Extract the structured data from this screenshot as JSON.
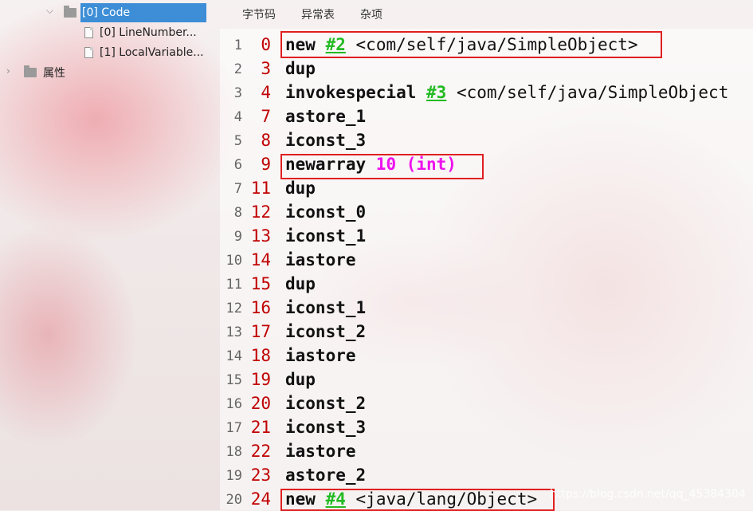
{
  "tree": {
    "code_node": "[0] Code",
    "line_number_node": "[0] LineNumber...",
    "local_variable_node": "[1] LocalVariable...",
    "attributes_node": "属性"
  },
  "tabs": [
    {
      "label": "字节码",
      "active": true
    },
    {
      "label": "异常表",
      "active": false
    },
    {
      "label": "杂项",
      "active": false
    }
  ],
  "code_lines": [
    {
      "ln": "1",
      "offset": "0",
      "op": "new",
      "ref": "#2",
      "arg": " <com/self/java/SimpleObject>",
      "lit": ""
    },
    {
      "ln": "2",
      "offset": "3",
      "op": "dup",
      "ref": "",
      "arg": "",
      "lit": ""
    },
    {
      "ln": "3",
      "offset": "4",
      "op": "invokespecial",
      "ref": "#3",
      "arg": " <com/self/java/SimpleObject",
      "lit": ""
    },
    {
      "ln": "4",
      "offset": "7",
      "op": "astore_1",
      "ref": "",
      "arg": "",
      "lit": ""
    },
    {
      "ln": "5",
      "offset": "8",
      "op": "iconst_3",
      "ref": "",
      "arg": "",
      "lit": ""
    },
    {
      "ln": "6",
      "offset": "9",
      "op": "newarray",
      "ref": "",
      "arg": "",
      "lit": " 10 (int)"
    },
    {
      "ln": "7",
      "offset": "11",
      "op": "dup",
      "ref": "",
      "arg": "",
      "lit": ""
    },
    {
      "ln": "8",
      "offset": "12",
      "op": "iconst_0",
      "ref": "",
      "arg": "",
      "lit": ""
    },
    {
      "ln": "9",
      "offset": "13",
      "op": "iconst_1",
      "ref": "",
      "arg": "",
      "lit": ""
    },
    {
      "ln": "10",
      "offset": "14",
      "op": "iastore",
      "ref": "",
      "arg": "",
      "lit": ""
    },
    {
      "ln": "11",
      "offset": "15",
      "op": "dup",
      "ref": "",
      "arg": "",
      "lit": ""
    },
    {
      "ln": "12",
      "offset": "16",
      "op": "iconst_1",
      "ref": "",
      "arg": "",
      "lit": ""
    },
    {
      "ln": "13",
      "offset": "17",
      "op": "iconst_2",
      "ref": "",
      "arg": "",
      "lit": ""
    },
    {
      "ln": "14",
      "offset": "18",
      "op": "iastore",
      "ref": "",
      "arg": "",
      "lit": ""
    },
    {
      "ln": "15",
      "offset": "19",
      "op": "dup",
      "ref": "",
      "arg": "",
      "lit": ""
    },
    {
      "ln": "16",
      "offset": "20",
      "op": "iconst_2",
      "ref": "",
      "arg": "",
      "lit": ""
    },
    {
      "ln": "17",
      "offset": "21",
      "op": "iconst_3",
      "ref": "",
      "arg": "",
      "lit": ""
    },
    {
      "ln": "18",
      "offset": "22",
      "op": "iastore",
      "ref": "",
      "arg": "",
      "lit": ""
    },
    {
      "ln": "19",
      "offset": "23",
      "op": "astore_2",
      "ref": "",
      "arg": "",
      "lit": ""
    },
    {
      "ln": "20",
      "offset": "24",
      "op": "new",
      "ref": "#4",
      "arg": " <java/lang/Object>",
      "lit": ""
    }
  ],
  "watermark": "https://blog.csdn.net/qq_45384304",
  "colors": {
    "selection": "#3d8ed6",
    "offset": "#c00000",
    "reference": "#22bb22",
    "literal": "#ee11ee",
    "highlight_box": "#e02020"
  },
  "icons": [
    "chevron-down-icon",
    "chevron-right-icon",
    "folder-icon",
    "file-icon"
  ]
}
